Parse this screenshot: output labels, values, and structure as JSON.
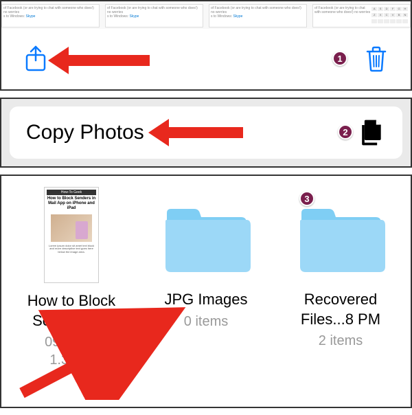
{
  "panel1": {
    "thumbnails": {
      "text1": "of Facebook (or are trying to chat with someone who does!) no worries",
      "text2": "s to Windows:",
      "skype": "Skype"
    }
  },
  "panel2": {
    "copy_label": "Copy Photos"
  },
  "panel3": {
    "items": [
      {
        "name": "How to Block Send...iPad",
        "date": "09/10/19",
        "size": "1.3 MB",
        "preview_header": "How-To Geek",
        "preview_title": "How to Block Senders in Mail App on iPhone and iPad"
      },
      {
        "name": "JPG Images",
        "meta": "0 items"
      },
      {
        "name": "Recovered Files...8 PM",
        "meta": "2 items"
      }
    ]
  },
  "badges": {
    "b1": "1",
    "b2": "2",
    "b3": "3"
  }
}
